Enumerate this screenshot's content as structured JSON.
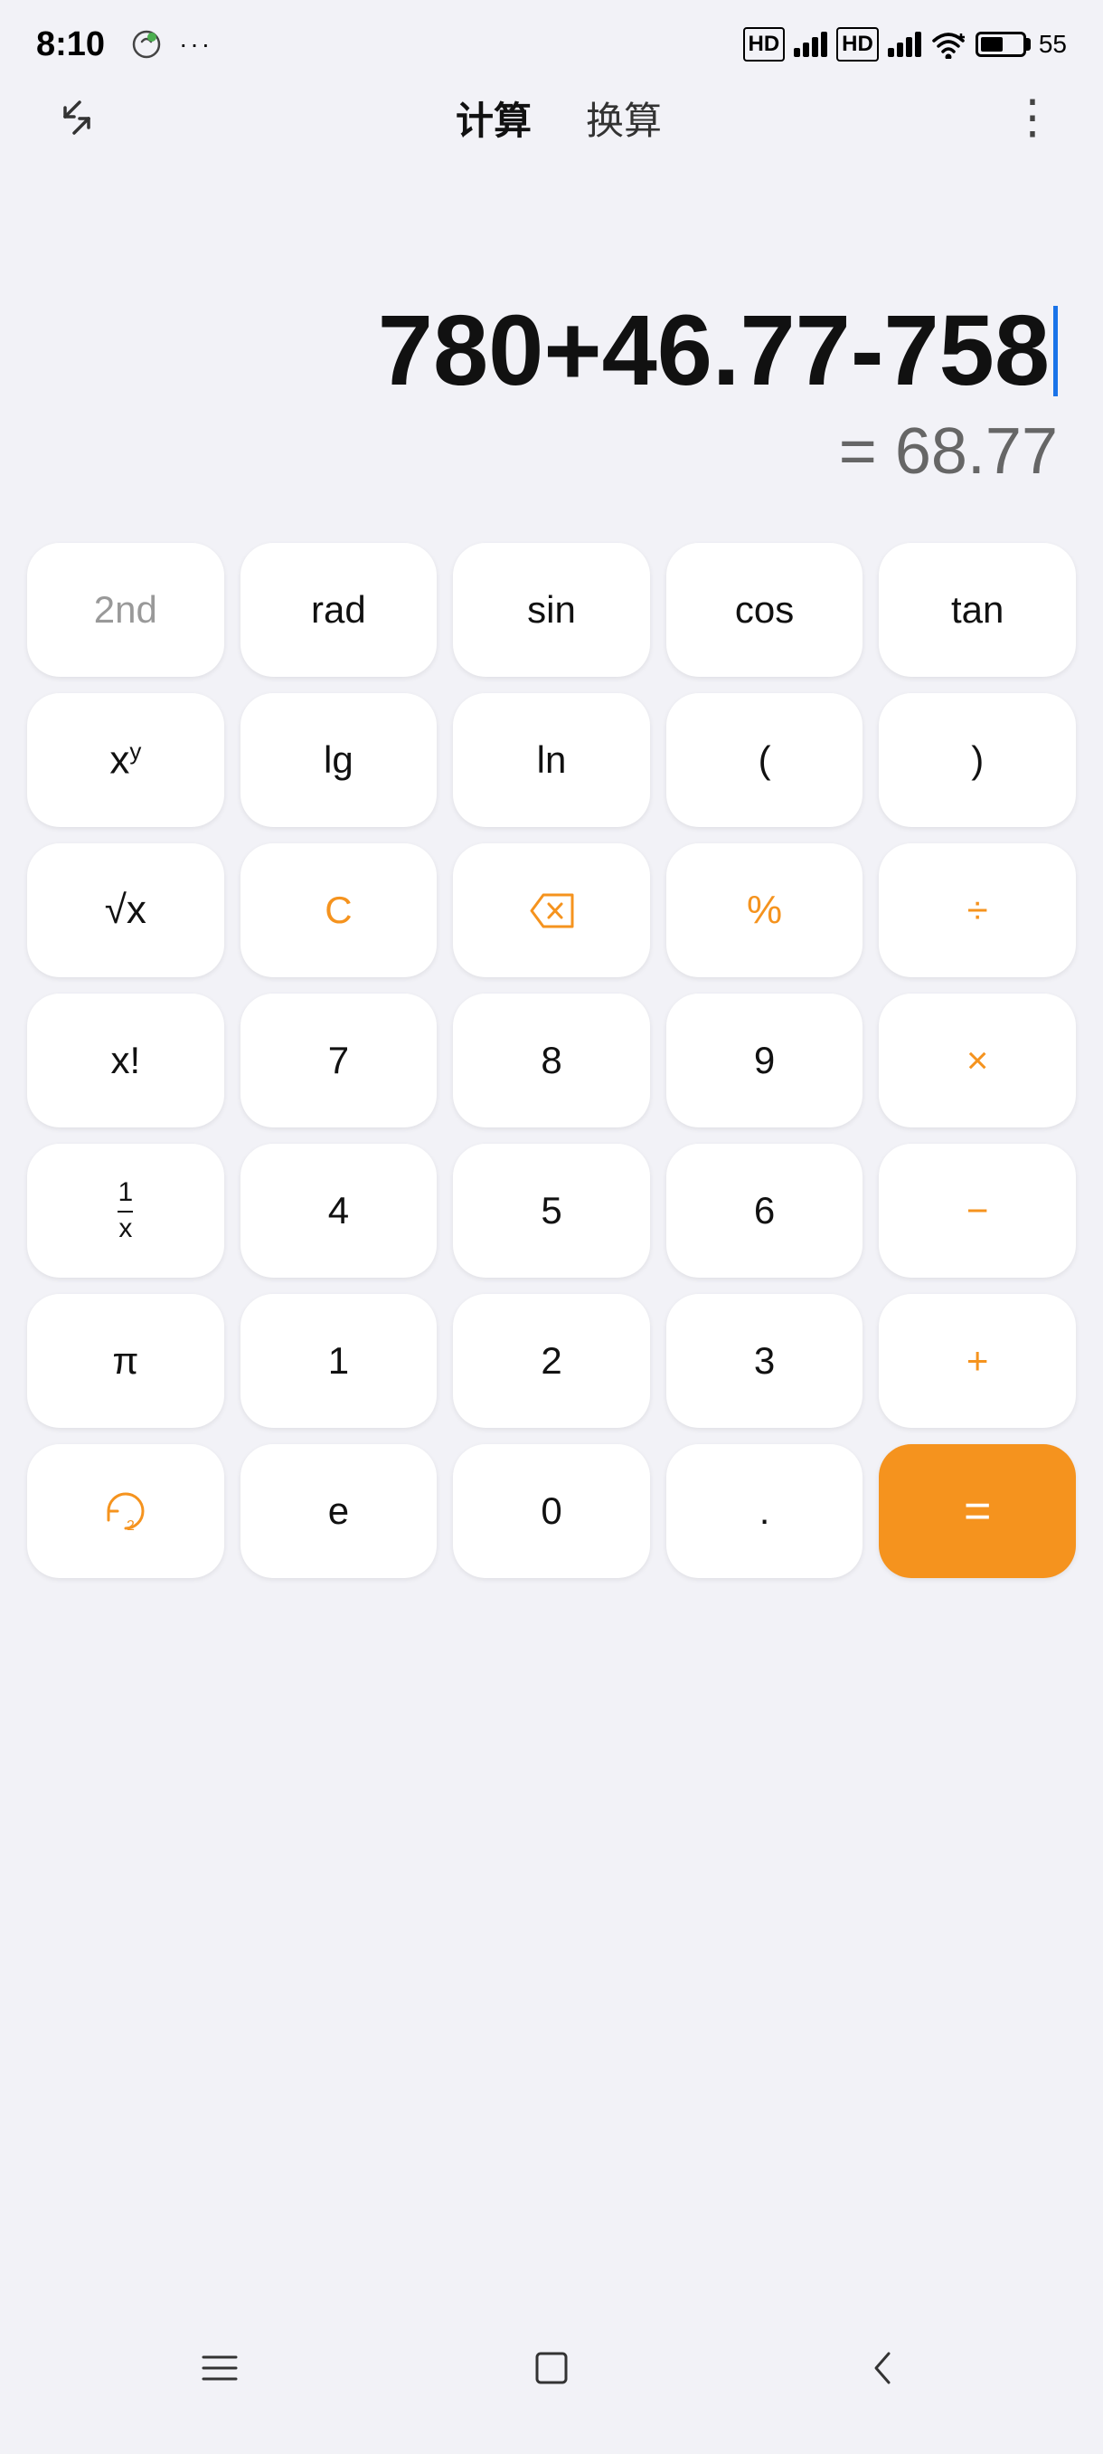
{
  "statusBar": {
    "time": "8:10",
    "battery": "55"
  },
  "topBar": {
    "tabs": [
      "计算",
      "换算"
    ],
    "activeTab": "计算",
    "menuLabel": "⋮"
  },
  "display": {
    "expression": "780+46.77-758",
    "result": "= 68.77",
    "cursorVisible": true
  },
  "keyboard": {
    "rows": [
      [
        {
          "label": "2nd",
          "type": "gray-text",
          "name": "key-2nd"
        },
        {
          "label": "rad",
          "type": "normal",
          "name": "key-rad"
        },
        {
          "label": "sin",
          "type": "normal",
          "name": "key-sin"
        },
        {
          "label": "cos",
          "type": "normal",
          "name": "key-cos"
        },
        {
          "label": "tan",
          "type": "normal",
          "name": "key-tan"
        }
      ],
      [
        {
          "label": "xy",
          "type": "xy",
          "name": "key-power"
        },
        {
          "label": "lg",
          "type": "normal",
          "name": "key-lg"
        },
        {
          "label": "ln",
          "type": "normal",
          "name": "key-ln"
        },
        {
          "label": "(",
          "type": "normal",
          "name": "key-open-paren"
        },
        {
          "label": ")",
          "type": "normal",
          "name": "key-close-paren"
        }
      ],
      [
        {
          "label": "√x",
          "type": "sqrt",
          "name": "key-sqrt"
        },
        {
          "label": "C",
          "type": "orange-text",
          "name": "key-clear"
        },
        {
          "label": "⌫",
          "type": "orange-text backspace",
          "name": "key-backspace"
        },
        {
          "label": "%",
          "type": "orange-text",
          "name": "key-percent"
        },
        {
          "label": "÷",
          "type": "orange-text",
          "name": "key-divide"
        }
      ],
      [
        {
          "label": "x!",
          "type": "normal",
          "name": "key-factorial"
        },
        {
          "label": "7",
          "type": "normal",
          "name": "key-7"
        },
        {
          "label": "8",
          "type": "normal",
          "name": "key-8"
        },
        {
          "label": "9",
          "type": "normal",
          "name": "key-9"
        },
        {
          "label": "×",
          "type": "orange-text",
          "name": "key-multiply"
        }
      ],
      [
        {
          "label": "1/x",
          "type": "fraction",
          "name": "key-reciprocal"
        },
        {
          "label": "4",
          "type": "normal",
          "name": "key-4"
        },
        {
          "label": "5",
          "type": "normal",
          "name": "key-5"
        },
        {
          "label": "6",
          "type": "normal",
          "name": "key-6"
        },
        {
          "label": "−",
          "type": "orange-text",
          "name": "key-subtract"
        }
      ],
      [
        {
          "label": "π",
          "type": "normal",
          "name": "key-pi"
        },
        {
          "label": "1",
          "type": "normal",
          "name": "key-1"
        },
        {
          "label": "2",
          "type": "normal",
          "name": "key-2"
        },
        {
          "label": "3",
          "type": "normal",
          "name": "key-3"
        },
        {
          "label": "+",
          "type": "orange-text",
          "name": "key-add"
        }
      ],
      [
        {
          "label": "♻",
          "type": "orange-text rotate",
          "name": "key-rotate"
        },
        {
          "label": "e",
          "type": "normal",
          "name": "key-e"
        },
        {
          "label": "0",
          "type": "normal",
          "name": "key-0"
        },
        {
          "label": ".",
          "type": "normal",
          "name": "key-dot"
        },
        {
          "label": "=",
          "type": "equals",
          "name": "key-equals"
        }
      ]
    ]
  },
  "bottomNav": {
    "home": "home",
    "recent": "recent",
    "back": "back"
  },
  "colors": {
    "orange": "#f5931e",
    "background": "#f2f2f7",
    "keyBg": "#ffffff",
    "cursor": "#1a73e8"
  }
}
